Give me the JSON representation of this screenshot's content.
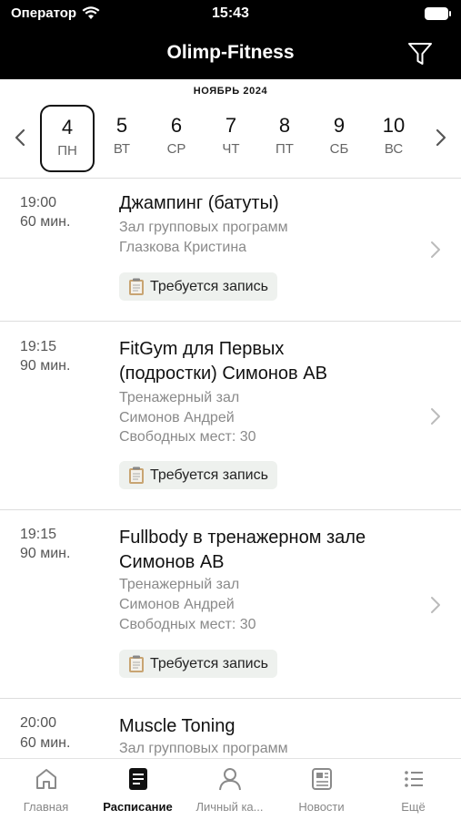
{
  "status_bar": {
    "carrier": "Оператор",
    "time": "15:43"
  },
  "navbar": {
    "title": "Olimp-Fitness"
  },
  "calendar": {
    "month": "НОЯБРЬ 2024",
    "days": [
      {
        "num": "4",
        "dow": "ПН",
        "selected": true
      },
      {
        "num": "5",
        "dow": "ВТ"
      },
      {
        "num": "6",
        "dow": "СР"
      },
      {
        "num": "7",
        "dow": "ЧТ"
      },
      {
        "num": "8",
        "dow": "ПТ"
      },
      {
        "num": "9",
        "dow": "СБ"
      },
      {
        "num": "10",
        "dow": "ВС"
      }
    ]
  },
  "sessions": [
    {
      "time": "19:00",
      "duration": "60 мин.",
      "name_lines": [
        "Джампинг (батуты)"
      ],
      "meta": [
        "Зал групповых программ",
        "Глазкова Кристина"
      ],
      "tag": "Требуется запись"
    },
    {
      "time": "19:15",
      "duration": "90 мин.",
      "name_lines": [
        "FitGym для Первых",
        "(подростки) Симонов АВ"
      ],
      "meta": [
        "Тренажерный зал",
        "Симонов Андрей",
        "Свободных мест: 30"
      ],
      "tag": "Требуется запись"
    },
    {
      "time": "19:15",
      "duration": "90 мин.",
      "name_lines": [
        "Fullbody в тренажерном зале",
        "Симонов АВ"
      ],
      "meta": [
        "Тренажерный зал",
        "Симонов Андрей",
        "Свободных мест: 30"
      ],
      "tag": "Требуется запись"
    },
    {
      "time": "20:00",
      "duration": "60 мин.",
      "name_lines": [
        "Muscle Toning"
      ],
      "meta": [
        "Зал групповых программ"
      ]
    }
  ],
  "tabbar": {
    "items": [
      {
        "label": "Главная",
        "icon": "home-icon"
      },
      {
        "label": "Расписание",
        "icon": "schedule-icon",
        "active": true
      },
      {
        "label": "Личный ка...",
        "icon": "profile-icon"
      },
      {
        "label": "Новости",
        "icon": "news-icon"
      },
      {
        "label": "Ещё",
        "icon": "more-icon"
      }
    ]
  }
}
